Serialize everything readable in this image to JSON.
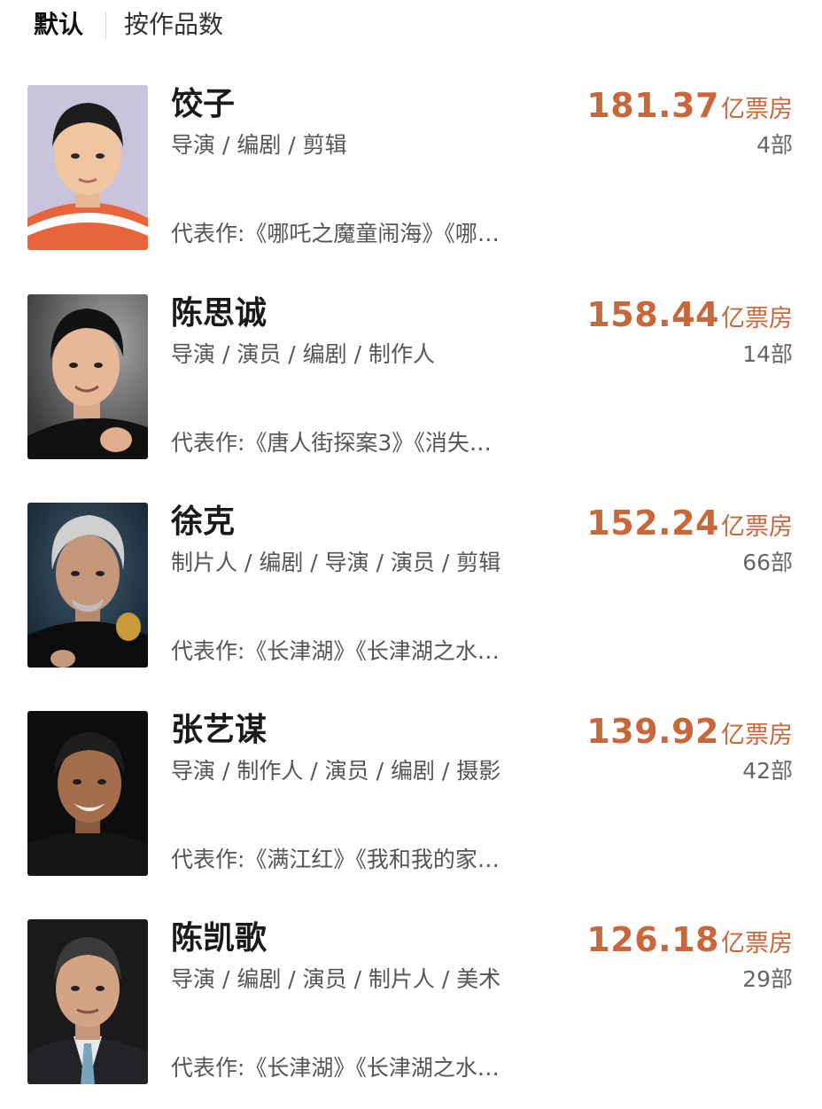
{
  "tabs": [
    {
      "label": "默认"
    },
    {
      "label": "按作品数"
    }
  ],
  "people": [
    {
      "name": "饺子",
      "roles": "导演 / 编剧 / 剪辑",
      "box_office": "181.37",
      "box_office_unit": "亿票房",
      "works_count": "4部",
      "representative": "代表作:《哪吒之魔童闹海》《哪…"
    },
    {
      "name": "陈思诚",
      "roles": "导演 / 演员 / 编剧 / 制作人",
      "box_office": "158.44",
      "box_office_unit": "亿票房",
      "works_count": "14部",
      "representative": "代表作:《唐人街探案3》《消失…"
    },
    {
      "name": "徐克",
      "roles": "制片人 / 编剧 / 导演 / 演员 / 剪辑",
      "box_office": "152.24",
      "box_office_unit": "亿票房",
      "works_count": "66部",
      "representative": "代表作:《长津湖》《长津湖之水…"
    },
    {
      "name": "张艺谋",
      "roles": "导演 / 制作人 / 演员 / 编剧 / 摄影",
      "box_office": "139.92",
      "box_office_unit": "亿票房",
      "works_count": "42部",
      "representative": "代表作:《满江红》《我和我的家…"
    },
    {
      "name": "陈凯歌",
      "roles": "导演 / 编剧 / 演员 / 制片人 / 美术",
      "box_office": "126.18",
      "box_office_unit": "亿票房",
      "works_count": "29部",
      "representative": "代表作:《长津湖》《长津湖之水…"
    }
  ],
  "colors": {
    "accent": "#c9673a",
    "text_primary": "#1a1a1a",
    "text_secondary": "#555555"
  }
}
